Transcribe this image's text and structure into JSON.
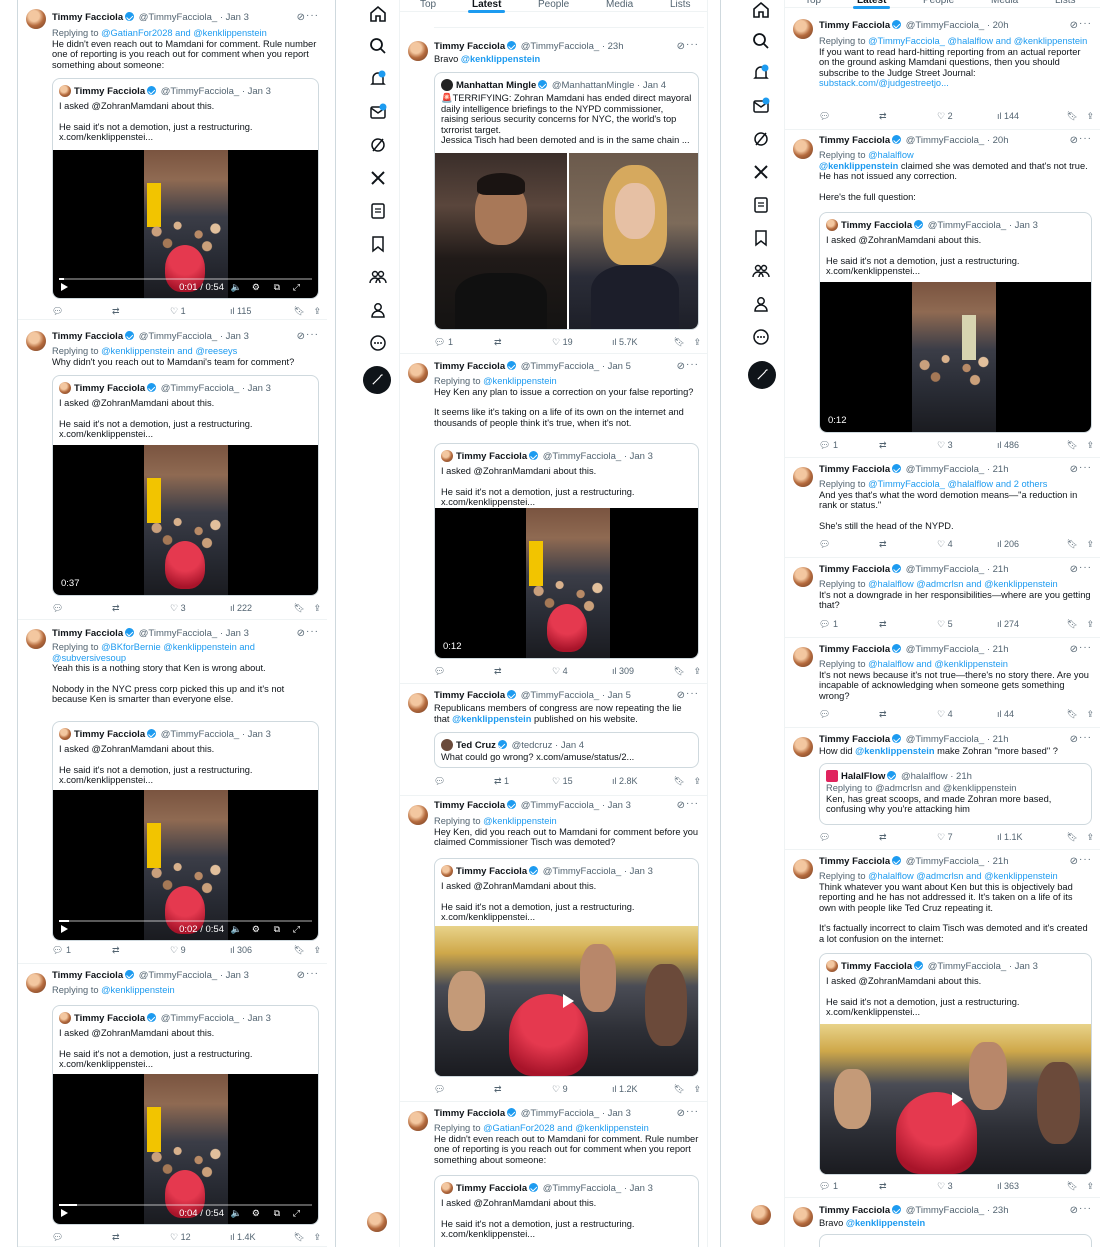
{
  "accent": "#1d9bf0",
  "tabs": {
    "top": "Top",
    "latest": "Latest",
    "people": "People",
    "media": "Media",
    "lists": "Lists"
  },
  "author": {
    "name": "Timmy Facciola",
    "handle": "@TimmyFacciola_"
  },
  "quote_std": {
    "author": "Timmy Facciola",
    "handle": "@TimmyFacciola_ · Jan 3",
    "line1": "I asked @ZohranMamdani about this.",
    "line2": "He said it's not a demotion, just a restructuring.",
    "line3": "x.com/kenklippenstei..."
  },
  "reply_prefix": "Replying to ",
  "col1": [
    {
      "date": "· Jan 3",
      "reply": "@GatianFor2028 and @kenklippenstein",
      "text": "He didn't even reach out to Mamdani for comment. Rule number one of reporting is you reach out for comment when you report something about someone:",
      "time": "0:01 / 0:54",
      "progress": 0.02,
      "replies": "",
      "retweets": "",
      "likes": "1",
      "views": "115"
    },
    {
      "date": "· Jan 3",
      "reply": "@kenklippenstein and @reeseys",
      "text": "Why didn't you reach out to Mamdani's team for comment?",
      "duration": "0:37",
      "replies": "",
      "retweets": "",
      "likes": "3",
      "views": "222"
    },
    {
      "date": "· Jan 3",
      "reply": "@BKforBernie @kenklippenstein and @subversivesoup",
      "text1": "Yeah this is a nothing story that Ken is wrong about.",
      "text2": "Nobody in the NYC press corp picked this up and it's not because Ken is smarter than everyone else.",
      "time": "0:02 / 0:54",
      "progress": 0.04,
      "replies": "1",
      "retweets": "",
      "likes": "9",
      "views": "306"
    },
    {
      "date": "· Jan 3",
      "reply": "@kenklippenstein",
      "time": "0:04 / 0:54",
      "progress": 0.07,
      "replies": "",
      "retweets": "",
      "likes": "12",
      "views": "1.4K"
    }
  ],
  "col2": [
    {
      "date": "· 23h",
      "text": "Bravo ",
      "mention": "@kenklippenstein",
      "q_name": "Manhattan Mingle",
      "q_handle": "@ManhattanMingle · Jan 4",
      "q_text": "🚨TERRIFYING: Zohran Mamdani has ended direct mayoral daily intelligence briefings to the NYPD commissioner, raising serious security concerns for NYC, the world's top txrrorist target.",
      "q_text2": "Jessica Tisch had been demoted and is in the same chain ...",
      "replies": "1",
      "retweets": "",
      "likes": "19",
      "views": "5.7K"
    },
    {
      "date": "· Jan 5",
      "reply": "@kenklippenstein",
      "text1": "Hey Ken any plan to issue a correction on your false reporting?",
      "text2": "It seems like it's taking on a life of its own on the internet and thousands of people think it's true, when it's not.",
      "duration": "0:12",
      "replies": "",
      "retweets": "",
      "likes": "4",
      "views": "309"
    },
    {
      "date": "· Jan 5",
      "text": "Republicans members of congress are now repeating the lie that ",
      "mention": "@kenklippenstein",
      "text_end": " published on his website.",
      "q_name": "Ted Cruz",
      "q_handle": "@tedcruz · Jan 4",
      "q_text": "What could go wrong? x.com/amuse/status/2...",
      "replies": "",
      "retweets": "1",
      "likes": "15",
      "views": "2.8K"
    },
    {
      "date": "· Jan 3",
      "reply": "@kenklippenstein",
      "text": "Hey Ken, did you reach out to Mamdani for comment before you claimed Commissioner Tisch was demoted?",
      "replies": "",
      "retweets": "",
      "likes": "9",
      "views": "1.2K"
    },
    {
      "date": "· Jan 3",
      "reply": "@GatianFor2028 and @kenklippenstein",
      "text": "He didn't even reach out to Mamdani for comment. Rule number one of reporting is you reach out for comment when you report something about someone:"
    }
  ],
  "col3": [
    {
      "date": "· 20h",
      "reply": "@TimmyFacciola_ @halalflow and @kenklippenstein",
      "text": "If you want to read hard-hitting reporting from an actual reporter on the ground asking Mamdani questions, then you should subscribe to the Judge Street Journal:",
      "link": "substack.com/@judgestreetjo...",
      "replies": "",
      "retweets": "",
      "likes": "2",
      "views": "144"
    },
    {
      "date": "· 20h",
      "reply": "@halalflow",
      "mention": "@kenklippenstein",
      "text": " claimed she was demoted and that's not true. He has not issued any correction.",
      "text2": "Here's the full question:",
      "duration": "0:12",
      "replies": "1",
      "retweets": "",
      "likes": "3",
      "views": "486"
    },
    {
      "date": "· 21h",
      "reply": "@TimmyFacciola_ @halalflow and 2 others",
      "text": "And yes that's what the word demotion means—\"a reduction in rank or status.\"",
      "text2": "She's still the head of the NYPD.",
      "replies": "",
      "retweets": "",
      "likes": "4",
      "views": "206"
    },
    {
      "date": "· 21h",
      "reply": "@halalflow @admcrlsn and @kenklippenstein",
      "text": "It's not a downgrade in her responsibilities—where are you getting that?",
      "replies": "1",
      "retweets": "",
      "likes": "5",
      "views": "274"
    },
    {
      "date": "· 21h",
      "reply": "@halalflow and @kenklippenstein",
      "text": "It's not news because it's not true—there's no story there. Are you incapable of acknowledging when someone gets something wrong?",
      "replies": "",
      "retweets": "",
      "likes": "4",
      "views": "44"
    },
    {
      "date": "· 21h",
      "pre": "How did ",
      "mention": "@kenklippenstein",
      "post": " make Zohran \"more based\" ?",
      "q_name": "HalalFlow",
      "q_handle": "@halalflow · 21h",
      "q_reply": "Replying to @admcrlsn and @kenklippenstein",
      "q_text": "Ken, has great scoops, and made Zohran more based, confusing why you're attacking him",
      "replies": "",
      "retweets": "",
      "likes": "7",
      "views": "1.1K"
    },
    {
      "date": "· 21h",
      "reply": "@halalflow @admcrlsn and @kenklippenstein",
      "text": "Think whatever you want about Ken but this is objectively bad reporting and he has not addressed it. It's taken on a life of its own with people like Ted Cruz repeating it.",
      "text2": "It's factually incorrect to claim Tisch was demoted and it's created a lot confusion on the internet:",
      "replies": "1",
      "retweets": "",
      "likes": "3",
      "views": "363"
    },
    {
      "date": "· 23h",
      "text": "Bravo ",
      "mention": "@kenklippenstein"
    }
  ],
  "truncated_views": "363"
}
